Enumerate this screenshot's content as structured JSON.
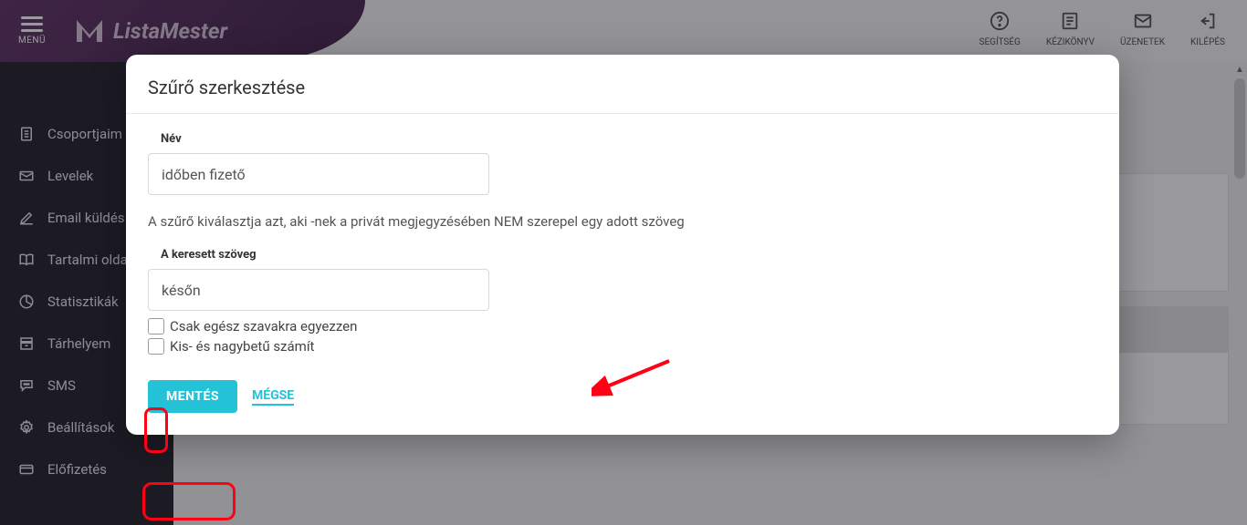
{
  "header": {
    "menu_label": "MENÜ",
    "brand": "ListaMester",
    "actions": [
      {
        "name": "help",
        "label": "SEGÍTSÉG",
        "icon": "?"
      },
      {
        "name": "handbook",
        "label": "KÉZIKÖNYV",
        "icon": "☰"
      },
      {
        "name": "messages",
        "label": "ÜZENETEK",
        "icon": "✉"
      },
      {
        "name": "logout",
        "label": "KILÉPÉS",
        "icon": "⎘"
      }
    ]
  },
  "sidebar": {
    "items": [
      {
        "name": "groups",
        "label": "Csoportjaim",
        "icon": "📋"
      },
      {
        "name": "letters",
        "label": "Levelek",
        "icon": "✉"
      },
      {
        "name": "send-email",
        "label": "Email küldés",
        "icon": "✎"
      },
      {
        "name": "content-pages",
        "label": "Tartalmi oldalak",
        "icon": "🕮"
      },
      {
        "name": "stats",
        "label": "Statisztikák",
        "icon": "◔"
      },
      {
        "name": "storage",
        "label": "Tárhelyem",
        "icon": "🗄"
      },
      {
        "name": "sms",
        "label": "SMS",
        "icon": "💬"
      },
      {
        "name": "settings",
        "label": "Beállítások",
        "icon": "⚙"
      },
      {
        "name": "subscription",
        "label": "Előfizetés",
        "icon": "💳"
      }
    ]
  },
  "modal": {
    "title": "Szűrő szerkesztése",
    "name_label": "Név",
    "name_value": "időben fizető",
    "description": "A szűrő kiválasztja azt, aki -nek a privát megjegyzésében NEM szerepel egy adott szöveg",
    "search_label": "A keresett szöveg",
    "search_value": "későn",
    "whole_words_label": "Csak egész szavakra egyezzen",
    "case_sensitive_label": "Kis- és nagybetű számít",
    "save_label": "MENTÉS",
    "cancel_label": "MÉGSE"
  },
  "annotations": {
    "arrow_color": "#ff0014",
    "ring_color": "#ff0014"
  },
  "icons": {
    "help": "?",
    "handbook": "🗒",
    "messages": "✉",
    "logout": "⇥"
  }
}
